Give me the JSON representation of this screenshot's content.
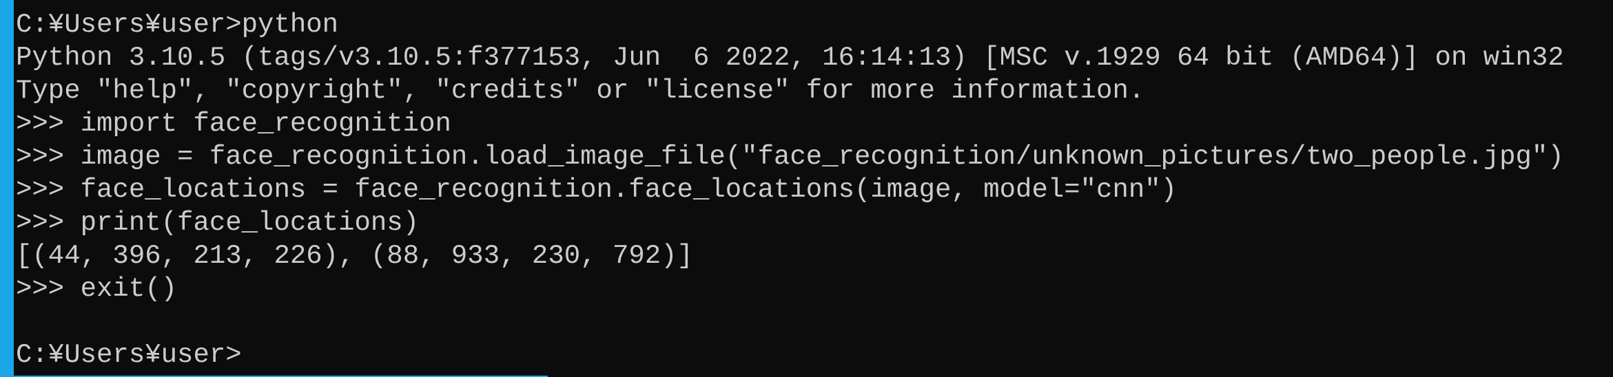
{
  "window": {
    "accent_color": "#1aa7e8",
    "background_color": "#0c0c0c",
    "text_color": "#cccccc"
  },
  "console": {
    "lines": [
      "C:¥Users¥user>python",
      "Python 3.10.5 (tags/v3.10.5:f377153, Jun  6 2022, 16:14:13) [MSC v.1929 64 bit (AMD64)] on win32",
      "Type \"help\", \"copyright\", \"credits\" or \"license\" for more information.",
      ">>> import face_recognition",
      ">>> image = face_recognition.load_image_file(\"face_recognition/unknown_pictures/two_people.jpg\")",
      ">>> face_locations = face_recognition.face_locations(image, model=\"cnn\")",
      ">>> print(face_locations)",
      "[(44, 396, 213, 226), (88, 933, 230, 792)]",
      ">>> exit()",
      "",
      "C:¥Users¥user>"
    ]
  }
}
